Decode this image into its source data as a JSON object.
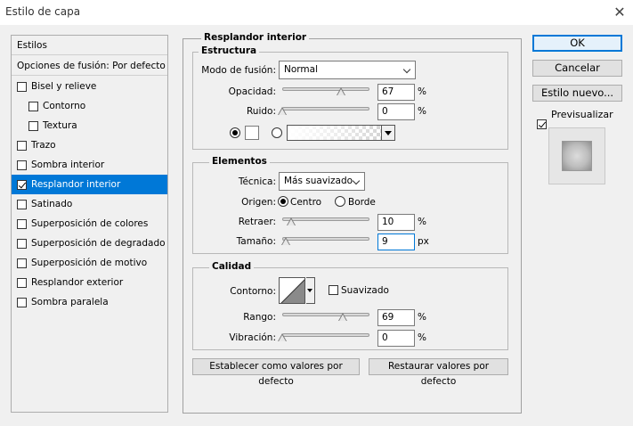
{
  "window": {
    "title": "Estilo de capa",
    "close_icon": "close-icon"
  },
  "left": {
    "header": "Estilos",
    "blend_options": "Opciones de fusión: Por defecto",
    "items": [
      {
        "label": "Bisel y relieve",
        "checked": false,
        "sub": false,
        "selected": false
      },
      {
        "label": "Contorno",
        "checked": false,
        "sub": true,
        "selected": false
      },
      {
        "label": "Textura",
        "checked": false,
        "sub": true,
        "selected": false
      },
      {
        "label": "Trazo",
        "checked": false,
        "sub": false,
        "selected": false
      },
      {
        "label": "Sombra interior",
        "checked": false,
        "sub": false,
        "selected": false
      },
      {
        "label": "Resplandor interior",
        "checked": true,
        "sub": false,
        "selected": true
      },
      {
        "label": "Satinado",
        "checked": false,
        "sub": false,
        "selected": false
      },
      {
        "label": "Superposición de colores",
        "checked": false,
        "sub": false,
        "selected": false
      },
      {
        "label": "Superposición de degradado",
        "checked": false,
        "sub": false,
        "selected": false
      },
      {
        "label": "Superposición de motivo",
        "checked": false,
        "sub": false,
        "selected": false
      },
      {
        "label": "Resplandor exterior",
        "checked": false,
        "sub": false,
        "selected": false
      },
      {
        "label": "Sombra paralela",
        "checked": false,
        "sub": false,
        "selected": false
      }
    ]
  },
  "main": {
    "title": "Resplandor interior",
    "structure": {
      "title": "Estructura",
      "blend_mode_label": "Modo de fusión:",
      "blend_mode_value": "Normal",
      "opacity_label": "Opacidad:",
      "opacity_value": "67",
      "opacity_fraction": 0.67,
      "noise_label": "Ruido:",
      "noise_value": "0",
      "noise_fraction": 0,
      "percent": "%"
    },
    "elements": {
      "title": "Elementos",
      "technique_label": "Técnica:",
      "technique_value": "Más suavizado",
      "source_label": "Origen:",
      "source_center": "Centro",
      "source_edge": "Borde",
      "choke_label": "Retraer:",
      "choke_value": "10",
      "choke_fraction": 0.1,
      "size_label": "Tamaño:",
      "size_value": "9",
      "size_fraction": 0.036,
      "percent": "%",
      "px": "px"
    },
    "quality": {
      "title": "Calidad",
      "contour_label": "Contorno:",
      "antialias_label": "Suavizado",
      "range_label": "Rango:",
      "range_value": "69",
      "range_fraction": 0.69,
      "jitter_label": "Vibración:",
      "jitter_value": "0",
      "jitter_fraction": 0,
      "percent": "%"
    },
    "make_default": "Establecer como valores por defecto",
    "reset_default": "Restaurar valores por defecto"
  },
  "right": {
    "ok": "OK",
    "cancel": "Cancelar",
    "new_style": "Estilo nuevo...",
    "preview_label": "Previsualizar",
    "preview_checked": true
  },
  "colors": {
    "accent": "#0078d7",
    "window_bg": "#f0f0f0"
  }
}
